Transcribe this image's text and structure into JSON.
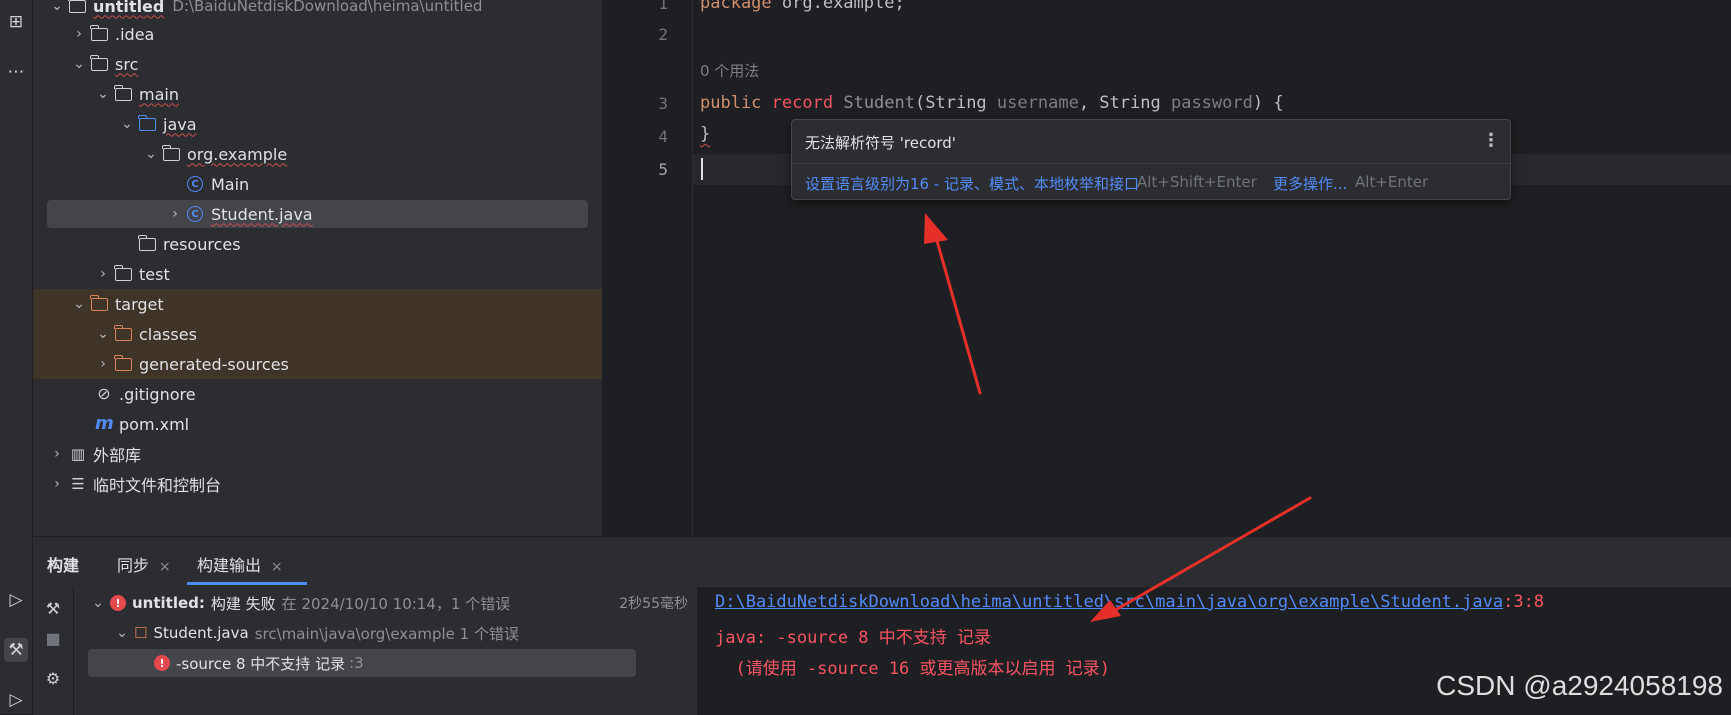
{
  "project_tree": {
    "root": {
      "name": "untitled",
      "path": "D:\\BaiduNetdiskDownload\\heima\\untitled"
    },
    "items": [
      {
        "label": ".idea"
      },
      {
        "label": "src"
      },
      {
        "label": "main"
      },
      {
        "label": "java"
      },
      {
        "label": "org.example"
      },
      {
        "label": "Main"
      },
      {
        "label": "Student.java"
      },
      {
        "label": "resources"
      },
      {
        "label": "test"
      },
      {
        "label": "target"
      },
      {
        "label": "classes"
      },
      {
        "label": "generated-sources"
      },
      {
        "label": ".gitignore"
      },
      {
        "label": "pom.xml"
      },
      {
        "label": "外部库"
      },
      {
        "label": "临时文件和控制台"
      }
    ]
  },
  "editor": {
    "line_numbers": [
      "1",
      "2",
      "3",
      "4",
      "5"
    ],
    "usage_hint": "0 个用法",
    "line1": {
      "kw": "package",
      "rest": " org.example;"
    },
    "line3": {
      "kw": "public",
      "record": "record",
      "name": "Student",
      "open": "(",
      "type1": "String",
      "param1": "username",
      "comma": ", ",
      "type2": "String",
      "param2": "password",
      "close": ") {"
    },
    "line4": "}"
  },
  "popup": {
    "title": "无法解析符号 'record'",
    "fix_label": "设置语言级别为16 - 记录、模式、本地枚举和接口",
    "fix_shortcut": "Alt+Shift+Enter",
    "more_label": "更多操作...",
    "more_shortcut": "Alt+Enter",
    "menu_icon": "vertical-dots-icon"
  },
  "bottom_panel": {
    "tabs": [
      {
        "label": "构建"
      },
      {
        "label": "同步"
      },
      {
        "label": "构建输出"
      }
    ],
    "close_glyph": "×",
    "build_tree": {
      "root_name": "untitled:",
      "root_status": "构建 失败",
      "root_detail": "在 2024/10/10 10:14，1 个错误",
      "root_time": "2秒55毫秒",
      "file_name": "Student.java",
      "file_detail": "src\\main\\java\\org\\example 1 个错误",
      "error_text": "-source 8 中不支持 记录",
      "error_pos": ":3"
    },
    "console": {
      "path_link": "D:\\BaiduNetdiskDownload\\heima\\untitled\\src\\main\\java\\org\\example\\Student.java",
      "path_suffix": ":3:8",
      "line2": "java: -source 8 中不支持 记录",
      "line3": "  (请使用 -source 16 或更高版本以启用 记录)"
    }
  },
  "watermark": "CSDN @a2924058198",
  "colors": {
    "accent_blue": "#548af7",
    "error_red": "#f75464",
    "arrow_red": "#e5302a",
    "excluded_folder_bg": "#3e3428"
  }
}
